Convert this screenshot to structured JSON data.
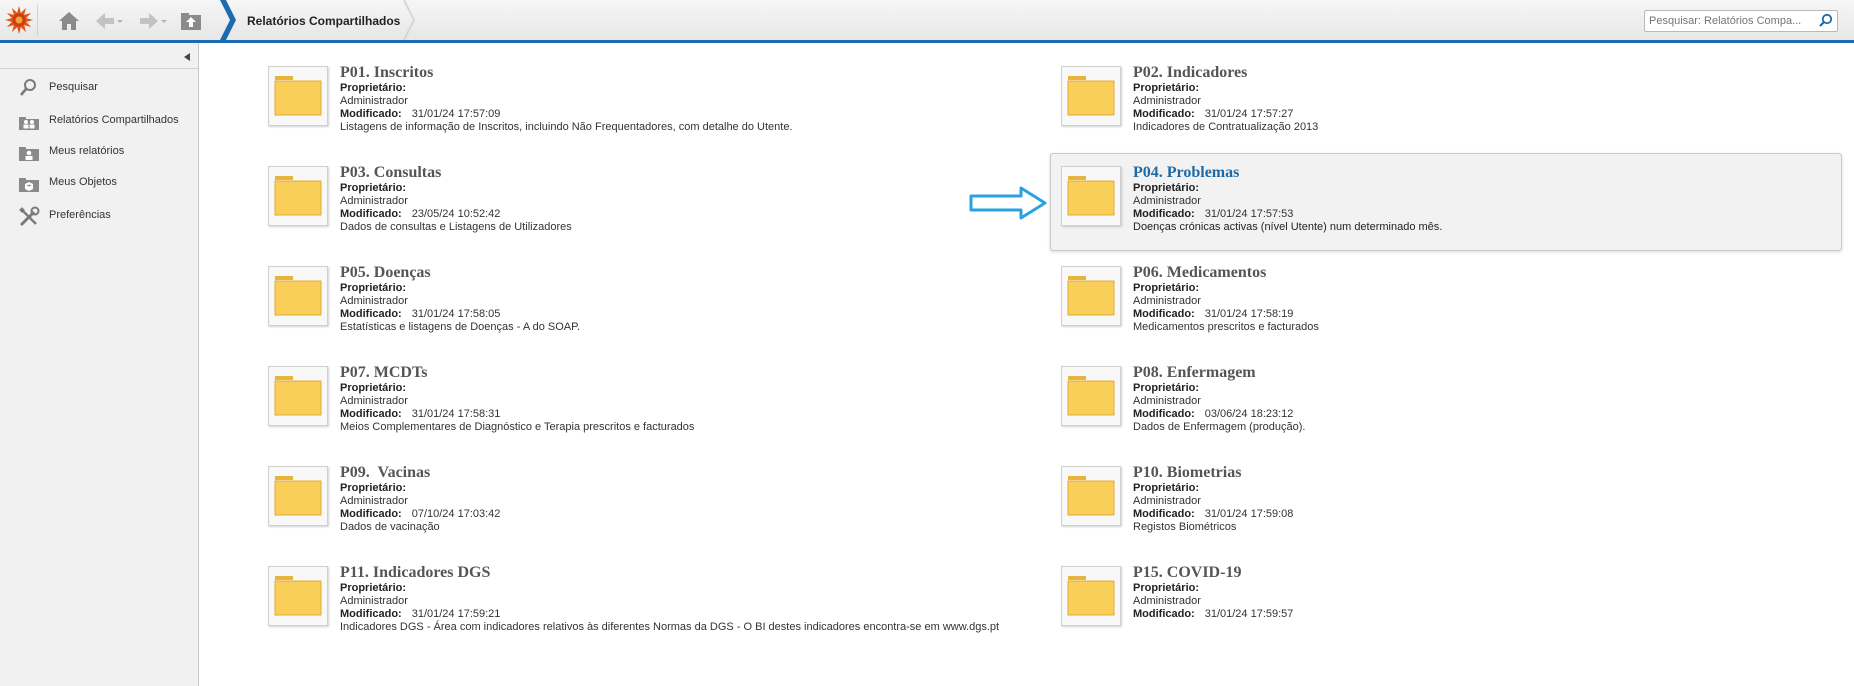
{
  "header": {
    "breadcrumb": "Relatórios Compartilhados",
    "search_placeholder": "Pesquisar: Relatórios Compa...",
    "icons": [
      "logo-icon",
      "home-icon",
      "back-icon",
      "forward-icon",
      "up-folder-icon",
      "search-icon"
    ]
  },
  "sidebar": {
    "items": [
      {
        "label": "Pesquisar",
        "icon": "magnifier-icon"
      },
      {
        "label": "Relatórios Compartilhados",
        "icon": "shared-users-icon"
      },
      {
        "label": "Meus relatórios",
        "icon": "user-folder-icon"
      },
      {
        "label": "Meus Objetos",
        "icon": "box-folder-icon"
      },
      {
        "label": "Preferências",
        "icon": "tools-icon"
      }
    ]
  },
  "labels": {
    "owner": "Proprietário:",
    "modified": "Modificado:"
  },
  "folders": [
    {
      "title": "P01. Inscritos",
      "owner": "Administrador",
      "modified": "31/01/24 17:57:09",
      "description": "Listagens de informação de Inscritos, incluindo Não Frequentadores, com detalhe do Utente."
    },
    {
      "title": "P02. Indicadores",
      "owner": "Administrador",
      "modified": "31/01/24 17:57:27",
      "description": "Indicadores de Contratualização 2013"
    },
    {
      "title": "P03. Consultas",
      "owner": "Administrador",
      "modified": "23/05/24 10:52:42",
      "description": "Dados de consultas e Listagens de Utilizadores"
    },
    {
      "title": "P04. Problemas",
      "owner": "Administrador",
      "modified": "31/01/24 17:57:53",
      "description": "Doenças crónicas activas (nível Utente) num determinado mês."
    },
    {
      "title": "P05. Doenças",
      "owner": "Administrador",
      "modified": "31/01/24 17:58:05",
      "description": "Estatísticas e listagens de Doenças - A do SOAP."
    },
    {
      "title": "P06. Medicamentos",
      "owner": "Administrador",
      "modified": "31/01/24 17:58:19",
      "description": "Medicamentos prescritos e facturados"
    },
    {
      "title": "P07. MCDTs",
      "owner": "Administrador",
      "modified": "31/01/24 17:58:31",
      "description": "Meios Complementares de Diagnóstico e Terapia prescritos e facturados"
    },
    {
      "title": "P08. Enfermagem",
      "owner": "Administrador",
      "modified": "03/06/24 18:23:12",
      "description": "Dados de Enfermagem (produção)."
    },
    {
      "title": "P09.  Vacinas",
      "owner": "Administrador",
      "modified": "07/10/24 17:03:42",
      "description": "Dados de vacinação"
    },
    {
      "title": "P10. Biometrias",
      "owner": "Administrador",
      "modified": "31/01/24 17:59:08",
      "description": "Registos Biométricos"
    },
    {
      "title": "P11. Indicadores DGS",
      "owner": "Administrador",
      "modified": "31/01/24 17:59:21",
      "description": "Indicadores DGS - Área com indicadores relativos às diferentes Normas da DGS - O BI destes indicadores encontra-se em www.dgs.pt"
    },
    {
      "title": "P15. COVID-19",
      "owner": "Administrador",
      "modified": "31/01/24 17:59:57",
      "description": ""
    }
  ],
  "selected_folder": "P04. Problemas",
  "colors": {
    "accent": "#1c6bb0",
    "selected_title": "#1d6aa6",
    "pointer_arrow": "#2aa2e0",
    "folder_fill": "#f9cf5a"
  }
}
